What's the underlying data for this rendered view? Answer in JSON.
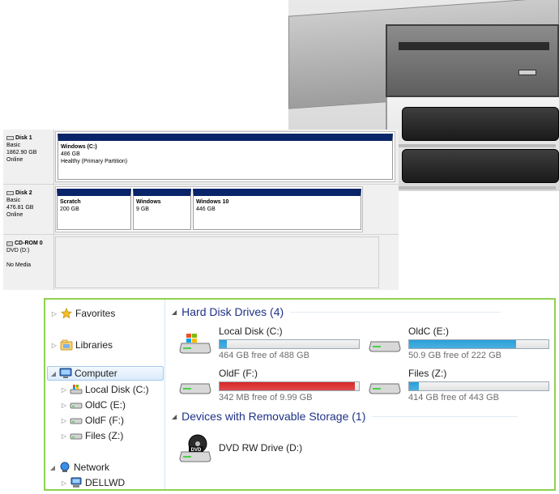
{
  "disk_management": {
    "disks": [
      {
        "name": "Disk 1",
        "type": "Basic",
        "size": "1862.90 GB",
        "status": "Online",
        "partitions": [
          {
            "name": "Windows (C:)",
            "size": "486 GB",
            "status": "Healthy (Primary Partition)"
          }
        ]
      },
      {
        "name": "Disk 2",
        "type": "Basic",
        "size": "476.81 GB",
        "status": "Online",
        "partitions": [
          {
            "name": "Scratch",
            "size": "200 GB"
          },
          {
            "name": "Windows",
            "size": "9 GB"
          },
          {
            "name": "Windows 10",
            "size": "446 GB"
          }
        ]
      },
      {
        "name": "CD-ROM 0",
        "type": "DVD (D:)",
        "status": "No Media"
      }
    ]
  },
  "explorer": {
    "nav": {
      "favorites": "Favorites",
      "libraries": "Libraries",
      "computer": "Computer",
      "drives": [
        "Local Disk (C:)",
        "OldC (E:)",
        "OldF (F:)",
        "Files (Z:)"
      ],
      "network": "Network",
      "network_items": [
        "DELLWD"
      ]
    },
    "groups": {
      "hdd": "Hard Disk Drives (4)",
      "removable": "Devices with Removable Storage (1)"
    },
    "drives": [
      {
        "name": "Local Disk (C:)",
        "free": "464 GB free of 488 GB",
        "used_fraction": 0.05,
        "bar_color": "#26a0da",
        "icon": "windows-hard-drive-icon"
      },
      {
        "name": "OldC (E:)",
        "free": "50.9 GB free of 222 GB",
        "used_fraction": 0.77,
        "bar_color": "#26a0da",
        "icon": "hard-drive-icon"
      },
      {
        "name": "OldF (F:)",
        "free": "342 MB free of 9.99 GB",
        "used_fraction": 0.97,
        "bar_color": "#da2626",
        "icon": "hard-drive-icon"
      },
      {
        "name": "Files (Z:)",
        "free": "414 GB free of 443 GB",
        "used_fraction": 0.07,
        "bar_color": "#26a0da",
        "icon": "hard-drive-icon"
      }
    ],
    "removable": [
      {
        "name": "DVD RW Drive (D:)",
        "icon": "dvd-drive-icon",
        "icon_label": "DVD"
      }
    ],
    "colors": {
      "accent_border": "#8fd14f",
      "group_header": "#1e3287",
      "bar_normal": "#26a0da",
      "bar_full": "#da2626"
    }
  }
}
